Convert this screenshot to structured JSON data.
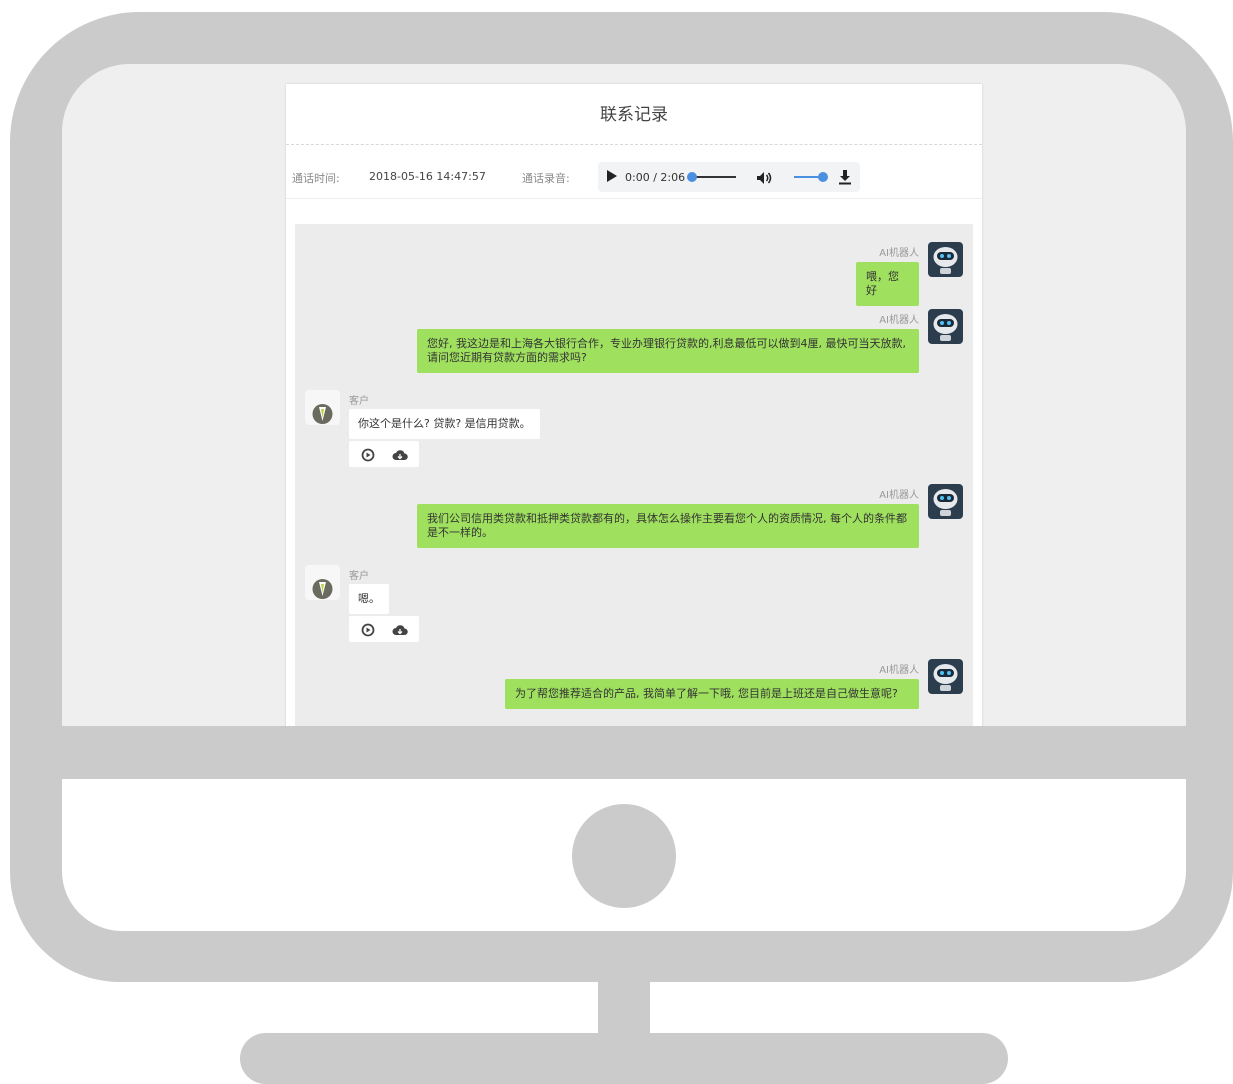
{
  "page": {
    "title": "联系记录"
  },
  "call": {
    "time_label": "通话时间:",
    "time_value": "2018-05-16 14:47:57",
    "recording_label": "通话录音:",
    "player_time": "0:00 / 2:06",
    "player_progress": 0.0,
    "volume_level": 1.0
  },
  "messages": [
    {
      "role": "ai",
      "sender": "AI机器人",
      "text": "喂，您好"
    },
    {
      "role": "ai",
      "sender": "AI机器人",
      "text": "您好, 我这边是和上海各大银行合作，专业办理银行贷款的,利息最低可以做到4厘, 最快可当天放款, 请问您近期有贷款方面的需求吗?"
    },
    {
      "role": "customer",
      "sender": "客户",
      "text": "你这个是什么? 贷款? 是信用贷款。"
    },
    {
      "role": "ai",
      "sender": "AI机器人",
      "text": "我们公司信用类贷款和抵押类贷款都有的，具体怎么操作主要看您个人的资质情况, 每个人的条件都是不一样的。"
    },
    {
      "role": "customer",
      "sender": "客户",
      "text": "嗯。"
    },
    {
      "role": "ai",
      "sender": "AI机器人",
      "text": "为了帮您推荐适合的产品, 我简单了解一下哦, 您目前是上班还是自己做生意呢?"
    }
  ],
  "icons": {
    "play": "play-icon",
    "volume": "volume-icon",
    "download": "download-icon",
    "message_play": "play-circle-icon",
    "message_download": "cloud-download-icon",
    "robot_avatar": "robot-avatar-icon",
    "customer_avatar": "customer-avatar-icon"
  },
  "colors": {
    "ai_bubble": "#9fe05f",
    "customer_bubble": "#ffffff",
    "accent": "#4a8fe0",
    "frame": "#cbcbcb"
  }
}
